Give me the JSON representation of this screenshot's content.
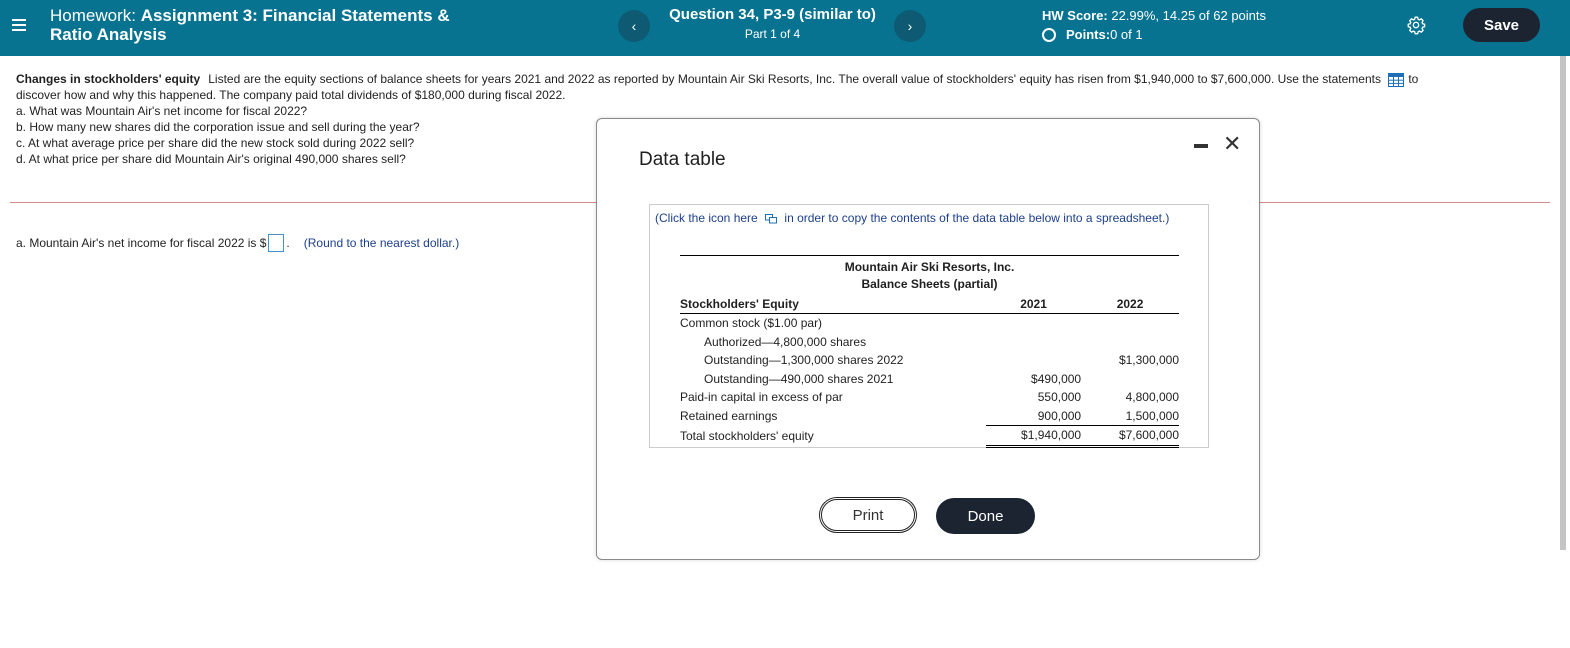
{
  "header": {
    "hw_prefix": "Homework: ",
    "hw_title_bold": "Assignment 3: Financial Statements &",
    "hw_title_line2": "Ratio Analysis",
    "question_title": "Question 34, P3-9 (similar to)",
    "question_part": "Part 1 of 4",
    "hw_score_label": "HW Score:",
    "hw_score_value": " 22.99%, 14.25 of 62 points",
    "points_label": "Points:",
    "points_value": " 0 of 1",
    "prev_icon": "chevron-left-icon",
    "next_icon": "chevron-right-icon",
    "prev_glyph": "‹",
    "next_glyph": "›",
    "save_label": "Save"
  },
  "question": {
    "lead": "Changes in stockholders' equity",
    "body": "Listed are the equity sections of balance sheets for years 2021 and 2022 as reported by Mountain Air Ski Resorts, Inc. The overall value of stockholders' equity has risen from $1,940,000 to $7,600,000.  Use the statements",
    "body_after_icon": "to",
    "body_line2": "discover how and why this happened. The company paid total dividends of $180,000 during fiscal 2022.",
    "items": [
      "a. What was Mountain Air's net income for fiscal 2022?",
      "b. How many new shares did the corporation issue and sell during the year?",
      "c. At what average price per share did the new stock sold during 2022 sell?",
      "d. At what price per share did Mountain Air's original 490,000 shares sell?"
    ],
    "answer_a_prefix": "a. Mountain Air's net income for fiscal 2022 is $",
    "answer_a_value": "",
    "answer_a_suffix": ".",
    "round_hint": "(Round to the nearest dollar.)"
  },
  "modal": {
    "title": "Data table",
    "copy_note_before": "(Click the icon here",
    "copy_note_after": "in order to copy the contents of the data table below into a spreadsheet.)",
    "company": "Mountain Air Ski Resorts, Inc.",
    "statement": "Balance Sheets (partial)",
    "col_label": "Stockholders' Equity",
    "col_2021": "2021",
    "col_2022": "2022",
    "rows": [
      {
        "label": "Common stock ($1.00 par)",
        "v2021": "",
        "v2022": ""
      },
      {
        "label": "Authorized—4,800,000 shares",
        "v2021": "",
        "v2022": ""
      },
      {
        "label": "Outstanding—1,300,000 shares 2022",
        "v2021": "",
        "v2022": "$1,300,000"
      },
      {
        "label": "Outstanding—490,000 shares 2021",
        "v2021": "$490,000",
        "v2022": ""
      },
      {
        "label": "Paid-in capital in excess of par",
        "v2021": "550,000",
        "v2022": "4,800,000"
      },
      {
        "label": "Retained earnings",
        "v2021": "900,000",
        "v2022": "1,500,000"
      },
      {
        "label": "Total stockholders' equity",
        "v2021": "$1,940,000",
        "v2022": "$7,600,000"
      }
    ],
    "print_label": "Print",
    "done_label": "Done"
  }
}
